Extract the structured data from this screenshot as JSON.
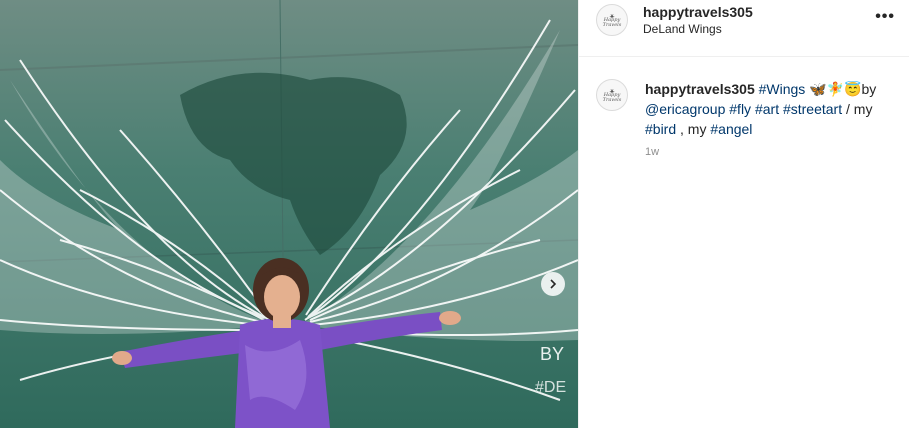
{
  "post": {
    "username": "happytravels305",
    "location": "DeLand Wings",
    "avatar_text": "Happy Travels",
    "more_label": "•••",
    "caption": {
      "username": "happytravels305",
      "parts": [
        {
          "text": "#Wings",
          "type": "hashtag"
        },
        {
          "text": " 🦋🧚😇by ",
          "type": "text"
        },
        {
          "text": "@ericagroup",
          "type": "mention"
        },
        {
          "text": " ",
          "type": "text"
        },
        {
          "text": "#fly",
          "type": "hashtag"
        },
        {
          "text": " ",
          "type": "text"
        },
        {
          "text": "#art",
          "type": "hashtag"
        },
        {
          "text": " ",
          "type": "text"
        },
        {
          "text": "#streetart",
          "type": "hashtag"
        },
        {
          "text": " / my ",
          "type": "text"
        },
        {
          "text": "#bird",
          "type": "hashtag"
        },
        {
          "text": " , my ",
          "type": "text"
        },
        {
          "text": "#angel",
          "type": "hashtag"
        }
      ]
    },
    "time_ago": "1w"
  },
  "photo": {
    "mural_text_1": "BY",
    "mural_text_2": "#DE"
  },
  "colors": {
    "link": "#00376b",
    "text": "#262626",
    "muted": "#8e8e8e",
    "wall": "#3f7a6e",
    "shirt": "#7a4fc4"
  }
}
